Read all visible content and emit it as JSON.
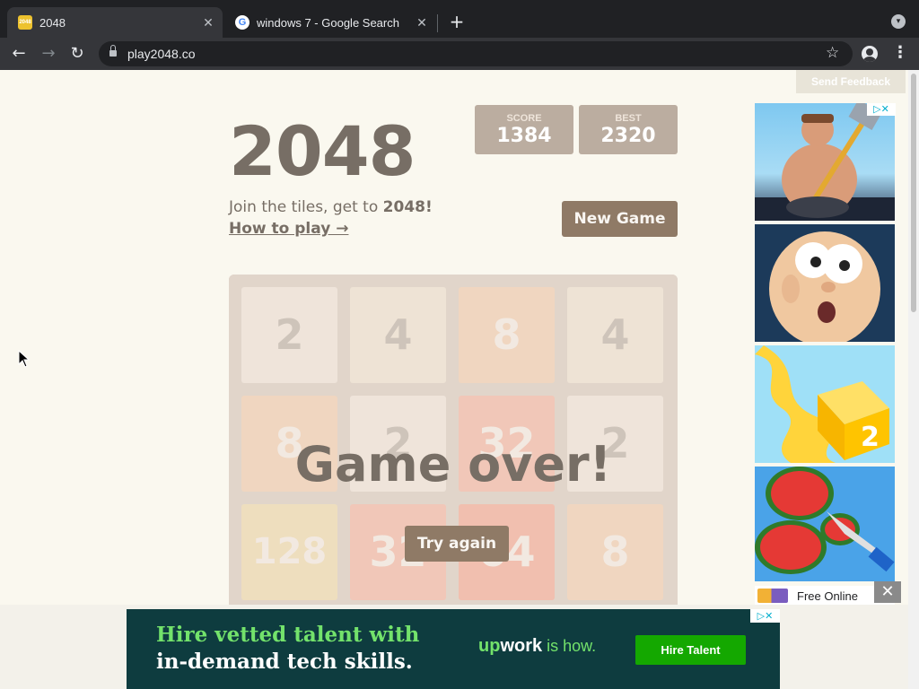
{
  "browser": {
    "tabs": [
      {
        "title": "2048",
        "favicon": "2048",
        "active": true
      },
      {
        "title": "windows 7 - Google Search",
        "favicon": "G",
        "active": false
      }
    ],
    "tab_close": "✕",
    "new_tab": "+",
    "url": "play2048.co"
  },
  "page": {
    "feedback": "Send Feedback",
    "title": "2048",
    "score_label": "SCORE",
    "score": "1384",
    "best_label": "BEST",
    "best": "2320",
    "intro_prefix": "Join the tiles, get to ",
    "intro_strong": "2048!",
    "howto": "How to play →",
    "new_game": "New Game",
    "board": [
      [
        "2",
        "4",
        "8",
        "4"
      ],
      [
        "8",
        "2",
        "32",
        "2"
      ],
      [
        "128",
        "32",
        "64",
        "8"
      ],
      [
        "",
        "",
        "",
        ""
      ]
    ],
    "game_over": "Game over!",
    "try_again": "Try again"
  },
  "side_ad": {
    "choices": "▷✕",
    "label": "Free Online",
    "close": "✕"
  },
  "bottom_ad": {
    "headline_1": "Hire vetted talent with",
    "headline_2": "in-demand tech skills.",
    "brand_up": "up",
    "brand_work": "work",
    "brand_how": " is how.",
    "cta": "Hire Talent",
    "choices": "▷✕"
  },
  "colors": {
    "tile_2": "#eee4da",
    "tile_4": "#ede0c8",
    "tile_8": "#f2b179",
    "tile_32": "#f67c5f",
    "tile_64": "#f65e3b",
    "tile_128": "#edcf72",
    "empty": "#cdc1b4"
  }
}
